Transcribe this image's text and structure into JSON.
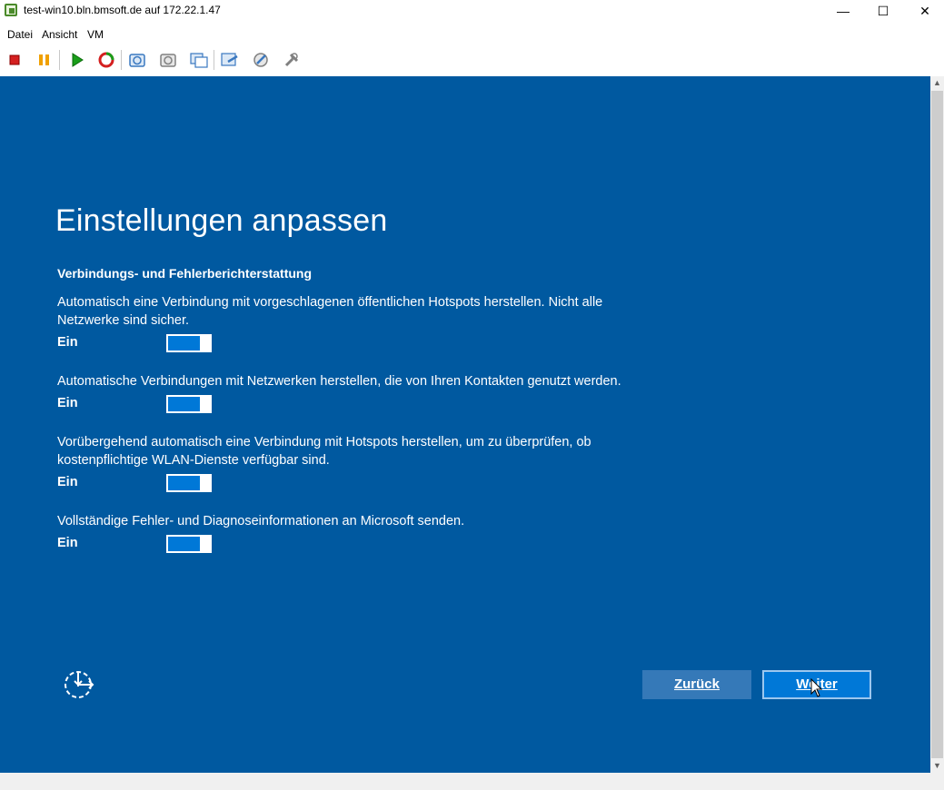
{
  "window": {
    "title": "test-win10.bln.bmsoft.de auf 172.22.1.47",
    "minimize_glyph": "—",
    "maximize_glyph": "☐",
    "close_glyph": "✕"
  },
  "menu": {
    "items": [
      {
        "label": "Datei"
      },
      {
        "label": "Ansicht"
      },
      {
        "label": "VM"
      }
    ]
  },
  "toolbar": {
    "buttons": [
      {
        "icon": "stop-icon",
        "color": "#d42020"
      },
      {
        "icon": "pause-icon",
        "color": "#f0a000"
      },
      {
        "icon": "play-icon",
        "color": "#1a9e1a"
      },
      {
        "icon": "reset-icon",
        "color": "#d42020"
      },
      {
        "icon": "snapshot-icon",
        "color": "#3a78c0"
      },
      {
        "icon": "revert-snapshot-icon",
        "color": "#808080"
      },
      {
        "icon": "manage-snapshots-icon",
        "color": "#3a78c0"
      },
      {
        "icon": "send-ctrl-alt-del-icon",
        "color": "#3a78c0"
      },
      {
        "icon": "tools-icon",
        "color": "#808080"
      },
      {
        "icon": "settings-icon",
        "color": "#808080"
      }
    ]
  },
  "oobe": {
    "title": "Einstellungen anpassen",
    "section_heading": "Verbindungs- und Fehlerberichterstattung",
    "settings": [
      {
        "description": "Automatisch eine Verbindung mit vorgeschlagenen öffentlichen Hotspots herstellen. Nicht alle Netzwerke sind sicher.",
        "state_label": "Ein",
        "on": true
      },
      {
        "description": "Automatische Verbindungen mit Netzwerken herstellen, die von Ihren Kontakten genutzt werden.",
        "state_label": "Ein",
        "on": true
      },
      {
        "description": "Vorübergehend automatisch eine Verbindung mit Hotspots herstellen, um zu überprüfen, ob kostenpflichtige WLAN-Dienste verfügbar sind.",
        "state_label": "Ein",
        "on": true
      },
      {
        "description": "Vollständige Fehler- und Diagnoseinformationen an Microsoft senden.",
        "state_label": "Ein",
        "on": true
      }
    ],
    "back_label": "Zurück",
    "next_label": "Weiter",
    "accent_color": "#0078d7",
    "background_color": "#0059a0"
  }
}
